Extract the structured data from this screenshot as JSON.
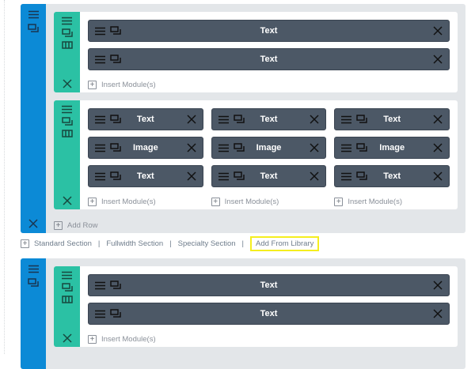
{
  "sections": [
    {
      "rows": [
        {
          "columns": [
            {
              "modules": [
                {
                  "label": "Text"
                },
                {
                  "label": "Text"
                }
              ],
              "insert_label": "Insert Module(s)"
            }
          ]
        },
        {
          "columns": [
            {
              "modules": [
                {
                  "label": "Text"
                },
                {
                  "label": "Image"
                },
                {
                  "label": "Text"
                }
              ],
              "insert_label": "Insert Module(s)"
            },
            {
              "modules": [
                {
                  "label": "Text"
                },
                {
                  "label": "Image"
                },
                {
                  "label": "Text"
                }
              ],
              "insert_label": "Insert Module(s)"
            },
            {
              "modules": [
                {
                  "label": "Text"
                },
                {
                  "label": "Image"
                },
                {
                  "label": "Text"
                }
              ],
              "insert_label": "Insert Module(s)"
            }
          ]
        }
      ],
      "add_row_label": "Add Row"
    },
    {
      "rows": [
        {
          "columns": [
            {
              "modules": [
                {
                  "label": "Text"
                },
                {
                  "label": "Text"
                }
              ],
              "insert_label": "Insert Module(s)"
            }
          ]
        }
      ]
    }
  ],
  "section_links": {
    "standard": "Standard Section",
    "fullwidth": "Fullwidth Section",
    "specialty": "Specialty Section",
    "library": "Add From Library",
    "separator": "|"
  },
  "colors": {
    "section": "#0c8ad6",
    "row": "#2bc1a4",
    "module": "#4c5866",
    "highlight": "#f5ee1f"
  }
}
